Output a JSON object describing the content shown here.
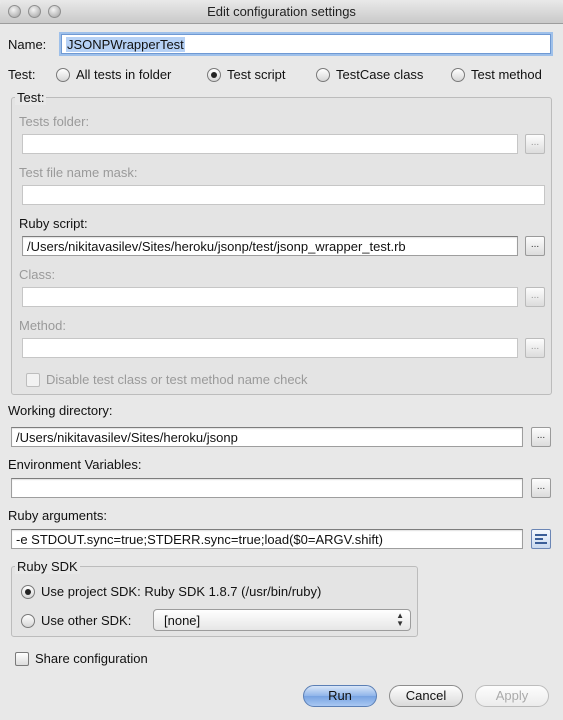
{
  "window": {
    "title": "Edit configuration settings"
  },
  "name": {
    "label": "Name:",
    "value": "JSONPWrapperTest"
  },
  "test_type": {
    "label": "Test:",
    "options": [
      {
        "label": "All tests in folder",
        "selected": false
      },
      {
        "label": "Test script",
        "selected": true
      },
      {
        "label": "TestCase class",
        "selected": false
      },
      {
        "label": "Test method",
        "selected": false
      }
    ]
  },
  "test_group": {
    "title": "Test:",
    "tests_folder": {
      "label": "Tests folder:",
      "value": ""
    },
    "file_mask": {
      "label": "Test file name mask:",
      "value": ""
    },
    "ruby_script": {
      "label": "Ruby script:",
      "value": "/Users/nikitavasilev/Sites/heroku/jsonp/test/jsonp_wrapper_test.rb"
    },
    "class": {
      "label": "Class:",
      "value": ""
    },
    "method": {
      "label": "Method:",
      "value": ""
    },
    "disable_check": {
      "label": "Disable test class or test method name check",
      "checked": false
    }
  },
  "browse_label": "...",
  "working_directory": {
    "label": "Working directory:",
    "value": "/Users/nikitavasilev/Sites/heroku/jsonp"
  },
  "env_vars": {
    "label": "Environment Variables:",
    "value": ""
  },
  "ruby_args": {
    "label": "Ruby arguments:",
    "value": "-e STDOUT.sync=true;STDERR.sync=true;load($0=ARGV.shift)"
  },
  "ruby_sdk": {
    "title": "Ruby SDK",
    "use_project": {
      "label": "Use project SDK: Ruby SDK 1.8.7 (/usr/bin/ruby)",
      "selected": true
    },
    "use_other": {
      "label": "Use other SDK:",
      "selected": false
    },
    "other_value": "[none]"
  },
  "share": {
    "label": "Share configuration",
    "checked": false
  },
  "buttons": {
    "run": "Run",
    "cancel": "Cancel",
    "apply": "Apply"
  },
  "colors": {
    "focus_ring": "#9ec0ea",
    "default_button": "#77a3e2",
    "window_bg": "#e8e8e8"
  }
}
